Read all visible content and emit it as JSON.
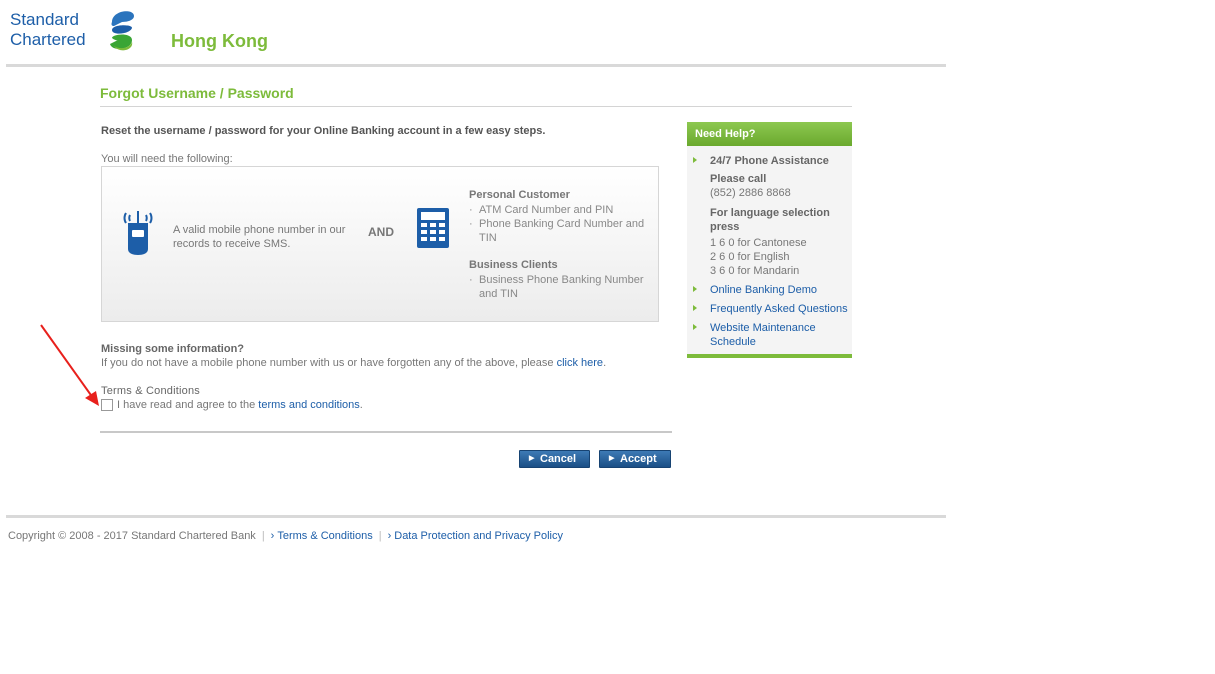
{
  "brand": {
    "line1": "Standard",
    "line2": "Chartered",
    "region": "Hong Kong"
  },
  "page": {
    "title": "Forgot Username / Password",
    "intro": "Reset the username / password for your Online Banking account in a few easy steps.",
    "need_label": "You will need the following:"
  },
  "requirements": {
    "phone_text": "A valid mobile phone number in our records to receive SMS.",
    "and_label": "AND",
    "personal_heading": "Personal Customer",
    "personal_items": [
      "ATM Card Number and PIN",
      "Phone Banking Card Number and TIN"
    ],
    "business_heading": "Business Clients",
    "business_items": [
      "Business Phone Banking Number and TIN"
    ]
  },
  "missing": {
    "heading": "Missing some information?",
    "text": "If you do not have a mobile phone number with us or have forgotten any of the above, please",
    "link": "click here",
    "suffix": "."
  },
  "terms": {
    "heading": "Terms & Conditions",
    "checkbox_text": "I have read and agree to the",
    "link": "terms and conditions",
    "suffix": ".",
    "checked": false
  },
  "buttons": {
    "cancel": "Cancel",
    "accept": "Accept"
  },
  "help": {
    "heading": "Need Help?",
    "phone_title": "24/7 Phone Assistance",
    "please_call": "Please call",
    "phone_number": "(852) 2886 8868",
    "language_title": "For language selection press",
    "options": [
      "1 6 0 for Cantonese",
      "2 6 0 for English",
      "3 6 0 for Mandarin"
    ],
    "links": [
      "Online Banking Demo",
      "Frequently Asked Questions",
      "Website Maintenance Schedule"
    ]
  },
  "footer": {
    "copyright": "Copyright © 2008 - 2017 Standard Chartered Bank",
    "links": [
      "Terms & Conditions",
      "Data Protection and Privacy Policy"
    ]
  },
  "colors": {
    "brand_green": "#7dbb3b",
    "brand_blue": "#1d5ea8",
    "button_blue": "#2a64a0",
    "annotation_red": "#e8201c"
  }
}
